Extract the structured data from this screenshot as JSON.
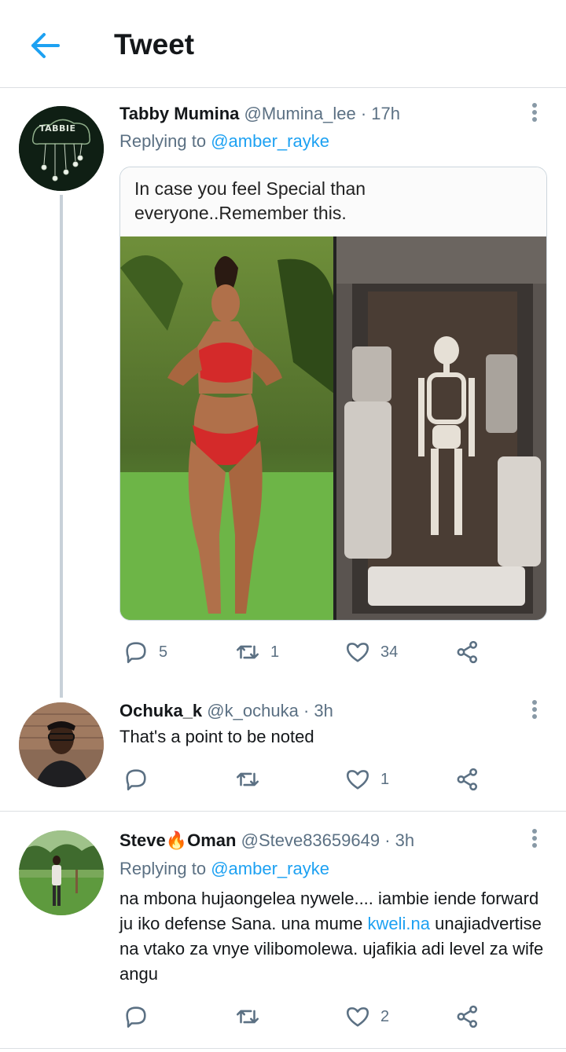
{
  "header": {
    "title": "Tweet"
  },
  "tweets": [
    {
      "name": "Tabby Mumina",
      "handle": "@Mumina_lee",
      "time": "· 17h",
      "replying_prefix": "Replying to",
      "replying_to": "@amber_rayke",
      "avatar_text": "TABBIE",
      "media_caption": "In case you feel Special than everyone..Remember this.",
      "replies": "5",
      "retweets": "1",
      "likes": "34"
    },
    {
      "name": "Ochuka_k",
      "handle": "@k_ochuka",
      "time": "· 3h",
      "text": "That's a point to be noted",
      "replies": "",
      "retweets": "",
      "likes": "1"
    },
    {
      "name_part1": "Steve",
      "name_emoji": "🔥",
      "name_part2": "Oman",
      "handle": "@Steve83659649",
      "time": "· 3h",
      "replying_prefix": "Replying to",
      "replying_to": "@amber_rayke",
      "text_before_link": "na mbona hujaongelea nywele.... iambie iende forward ju iko defense Sana. una mume ",
      "link": "kweli.na",
      "text_after_link": " unajiadvertise na vtako za vnye vilibomolewa. ujafikia adi level za wife angu",
      "replies": "",
      "retweets": "",
      "likes": "2"
    }
  ],
  "colors": {
    "accent": "#1da1f2",
    "muted": "#5b7083",
    "divider": "#dcdfe3"
  },
  "icons": [
    "back-arrow-icon",
    "more-vertical-icon",
    "reply-icon",
    "retweet-icon",
    "like-icon",
    "share-icon"
  ]
}
